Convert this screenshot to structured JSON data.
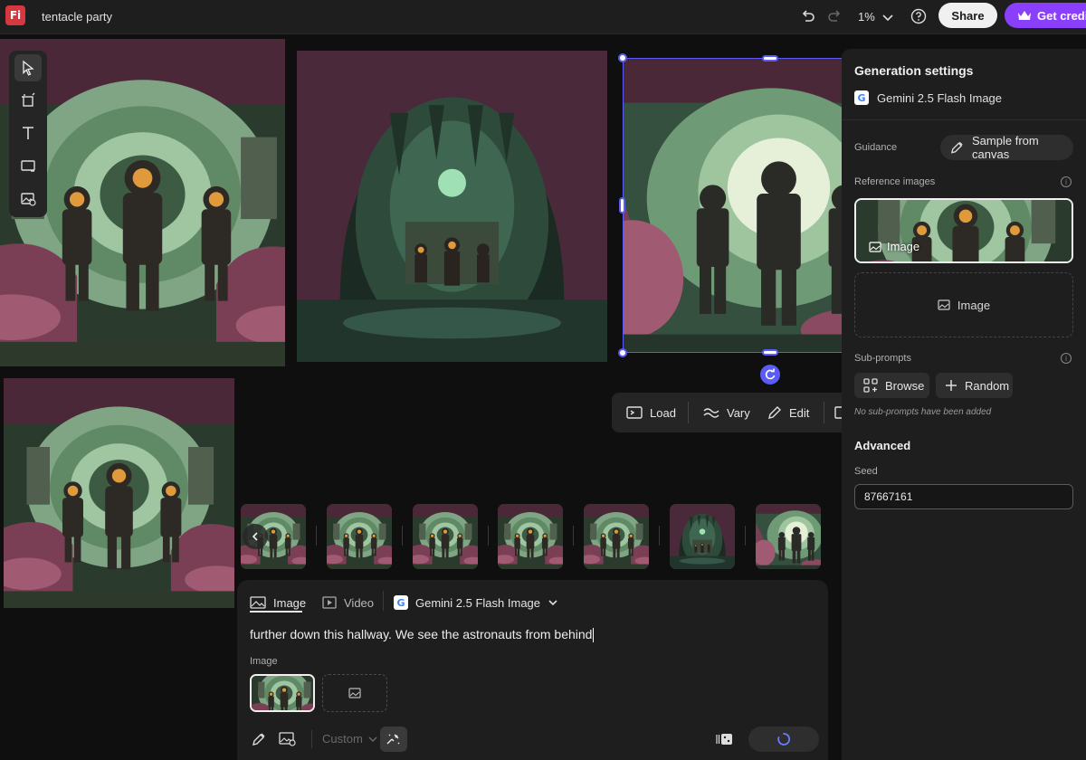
{
  "app": {
    "logo": "Fi",
    "document_title": "tentacle party",
    "zoom": "1%",
    "share_label": "Share",
    "credits_label": "Get credits",
    "accent_color": "#5b5bf5",
    "credits_color": "#8a3ffc"
  },
  "toolbar": {
    "tools": [
      "select-icon",
      "artboard-icon",
      "text-icon",
      "shape-icon",
      "generate-image-icon"
    ]
  },
  "actionbar": {
    "load_label": "Load",
    "vary_label": "Vary",
    "edit_label": "Edit"
  },
  "prompt": {
    "tabs": {
      "image": "Image",
      "video": "Video"
    },
    "model": "Gemini 2.5 Flash Image",
    "text": "further down this hallway. We see the astronauts from behind",
    "image_label": "Image",
    "style_dropdown": "Custom"
  },
  "settings": {
    "title": "Generation settings",
    "model": "Gemini 2.5 Flash Image",
    "model_badge": "G",
    "guidance_label": "Guidance",
    "sample_label": "Sample from canvas",
    "reference_label": "Reference images",
    "ref_image_label": "Image",
    "ref_empty_label": "Image",
    "subprompts_label": "Sub-prompts",
    "browse_label": "Browse",
    "random_label": "Random",
    "no_subprompts": "No sub-prompts have been added",
    "advanced_label": "Advanced",
    "seed_label": "Seed",
    "seed_value": "87667161"
  }
}
